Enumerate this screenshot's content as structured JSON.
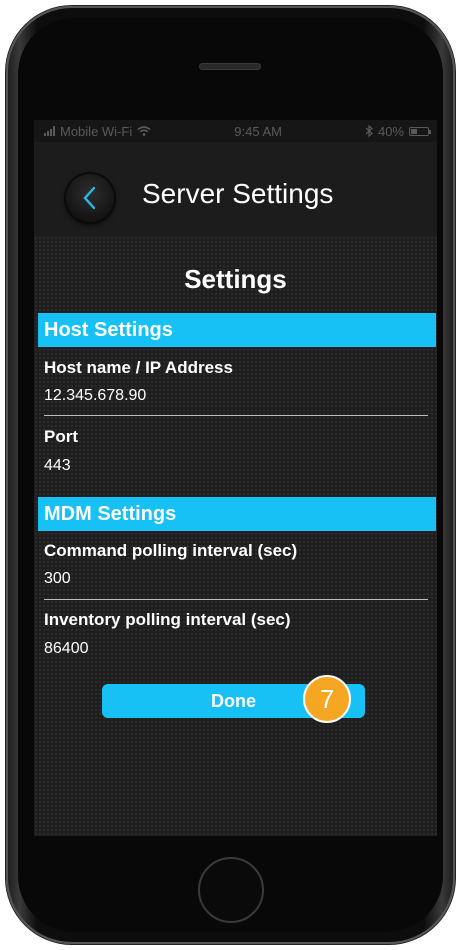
{
  "status_bar": {
    "carrier": "Mobile Wi-Fi",
    "time": "9:45 AM",
    "battery_percent": "40%",
    "battery_level": 0.4,
    "icons": [
      "signal-icon",
      "wifi-icon",
      "bluetooth-icon",
      "battery-icon"
    ]
  },
  "nav": {
    "back_icon": "chevron-left-icon",
    "title": "Server Settings"
  },
  "settings": {
    "heading": "Settings",
    "host_section": {
      "header": "Host Settings",
      "host_label": "Host name / IP Address",
      "host_value": "12.345.678.90",
      "port_label": "Port",
      "port_value": "443"
    },
    "mdm_section": {
      "header": "MDM Settings",
      "command_label": "Command polling interval (sec)",
      "command_value": "300",
      "inventory_label": "Inventory polling interval (sec)",
      "inventory_value": "86400"
    },
    "done_label": "Done"
  },
  "annotation": {
    "step_number": "7"
  },
  "colors": {
    "accent": "#17c0f5",
    "badge": "#f5a623",
    "background": "#1e1e1e"
  }
}
